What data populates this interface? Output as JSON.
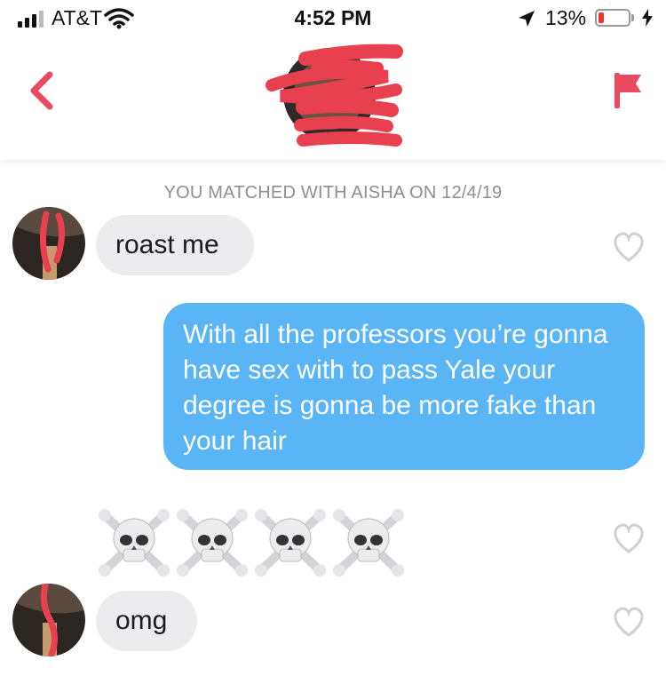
{
  "status_bar": {
    "carrier": "AT&T",
    "time": "4:52 PM",
    "battery_percent": "13%",
    "battery_level": 0.13
  },
  "header": {
    "back_icon": "chevron-left-icon",
    "report_icon": "flag-icon",
    "accent_color": "#e84a5f"
  },
  "chat": {
    "match_notice": "YOU MATCHED WITH AISHA ON 12/4/19",
    "messages": [
      {
        "from": "them",
        "text": "roast me"
      },
      {
        "from": "me",
        "text": "With all the professors you’re gonna have sex with to pass Yale your degree is gonna be more fake than your hair"
      },
      {
        "from": "them",
        "text": "☠️☠️☠️☠️",
        "kind": "emoji",
        "emoji_icon": "skull-crossbones-icon",
        "count": 4
      },
      {
        "from": "them",
        "text": "omg"
      }
    ]
  },
  "colors": {
    "outgoing_bubble": "#5ab5f7",
    "incoming_bubble": "#ececee",
    "redaction": "#e8404e"
  }
}
